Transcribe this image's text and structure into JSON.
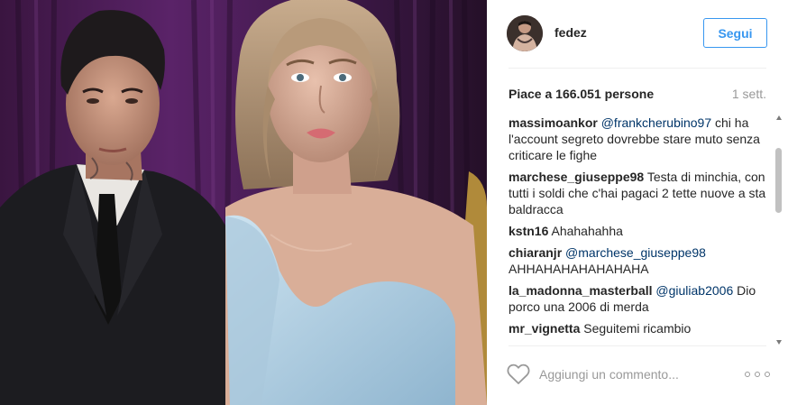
{
  "post": {
    "username": "fedez",
    "follow_label": "Segui",
    "likes_text": "Piace a 166.051 persone",
    "time_ago": "1 sett."
  },
  "comments": [
    {
      "user": "massimoankor",
      "mention": "@frankcherubino97",
      "text": " chi ha l'account segreto dovrebbe stare muto senza criticare le fighe"
    },
    {
      "user": "marchese_giuseppe98",
      "mention": "",
      "text": " Testa di minchia, con tutti i soldi che c'hai pagaci 2 tette nuove a sta baldracca"
    },
    {
      "user": "kstn16",
      "mention": "",
      "text": " Ahahahahha"
    },
    {
      "user": "chiaranjr",
      "mention": "@marchese_giuseppe98",
      "text": " AHHAHAHAHAHAHAHA"
    },
    {
      "user": "la_madonna_masterball",
      "mention": "@giuliab2006",
      "text": " Dio porco una 2006 di merda"
    },
    {
      "user": "mr_vignetta",
      "mention": "",
      "text": " Seguitemi ricambio"
    }
  ],
  "footer": {
    "comment_placeholder": "Aggiungi un commento..."
  },
  "icons": {
    "like": "heart-icon",
    "more": "more-options-icon"
  },
  "colors": {
    "accent": "#3897f0",
    "mention": "#003569",
    "muted": "#999999"
  }
}
